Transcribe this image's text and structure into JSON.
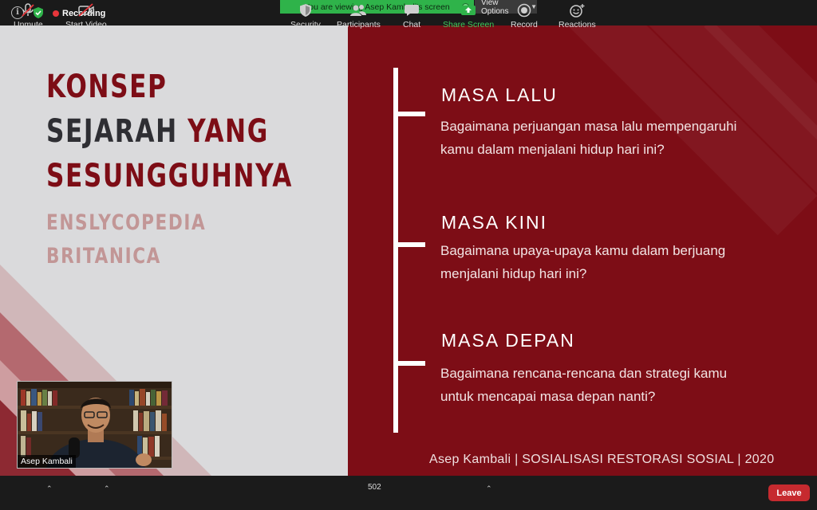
{
  "topbar": {
    "recording_label": "Recording",
    "viewing_banner": "You are viewing Asep Kambali's screen",
    "view_options_label": "View Options"
  },
  "slide": {
    "title_line1": "KONSEP",
    "title_line2_a": "SEJARAH",
    "title_line2_b": "YANG",
    "title_line3": "SESUNGGUHNYA",
    "subtitle_line1": "ENSLYCOPEDIA",
    "subtitle_line2": "BRITANICA",
    "sections": [
      {
        "title": "MASA LALU",
        "body_line1": "Bagaimana perjuangan masa lalu mempengaruhi",
        "body_line2": "kamu dalam menjalani hidup hari ini?"
      },
      {
        "title": "MASA KINI",
        "body_line1": "Bagaimana upaya-upaya kamu dalam berjuang",
        "body_line2": "menjalani hidup hari ini?"
      },
      {
        "title": "MASA DEPAN",
        "body_line1": "Bagaimana rencana-rencana dan strategi kamu",
        "body_line2": "untuk mencapai masa depan nanti?"
      }
    ],
    "footer": "Asep Kambali | SOSIALISASI RESTORASI SOSIAL | 2020"
  },
  "video": {
    "participant_name": "Asep Kambali"
  },
  "toolbar": {
    "unmute_label": "Unmute",
    "start_video_label": "Start Video",
    "security_label": "Security",
    "participants_label": "Participants",
    "participants_count": "502",
    "chat_label": "Chat",
    "share_screen_label": "Share Screen",
    "record_label": "Record",
    "reactions_label": "Reactions",
    "leave_label": "Leave"
  },
  "colors": {
    "slide_red": "#7d0d16",
    "slide_gray": "#dadadc",
    "share_green": "#2fb34a",
    "leave_red": "#c62a2f"
  }
}
